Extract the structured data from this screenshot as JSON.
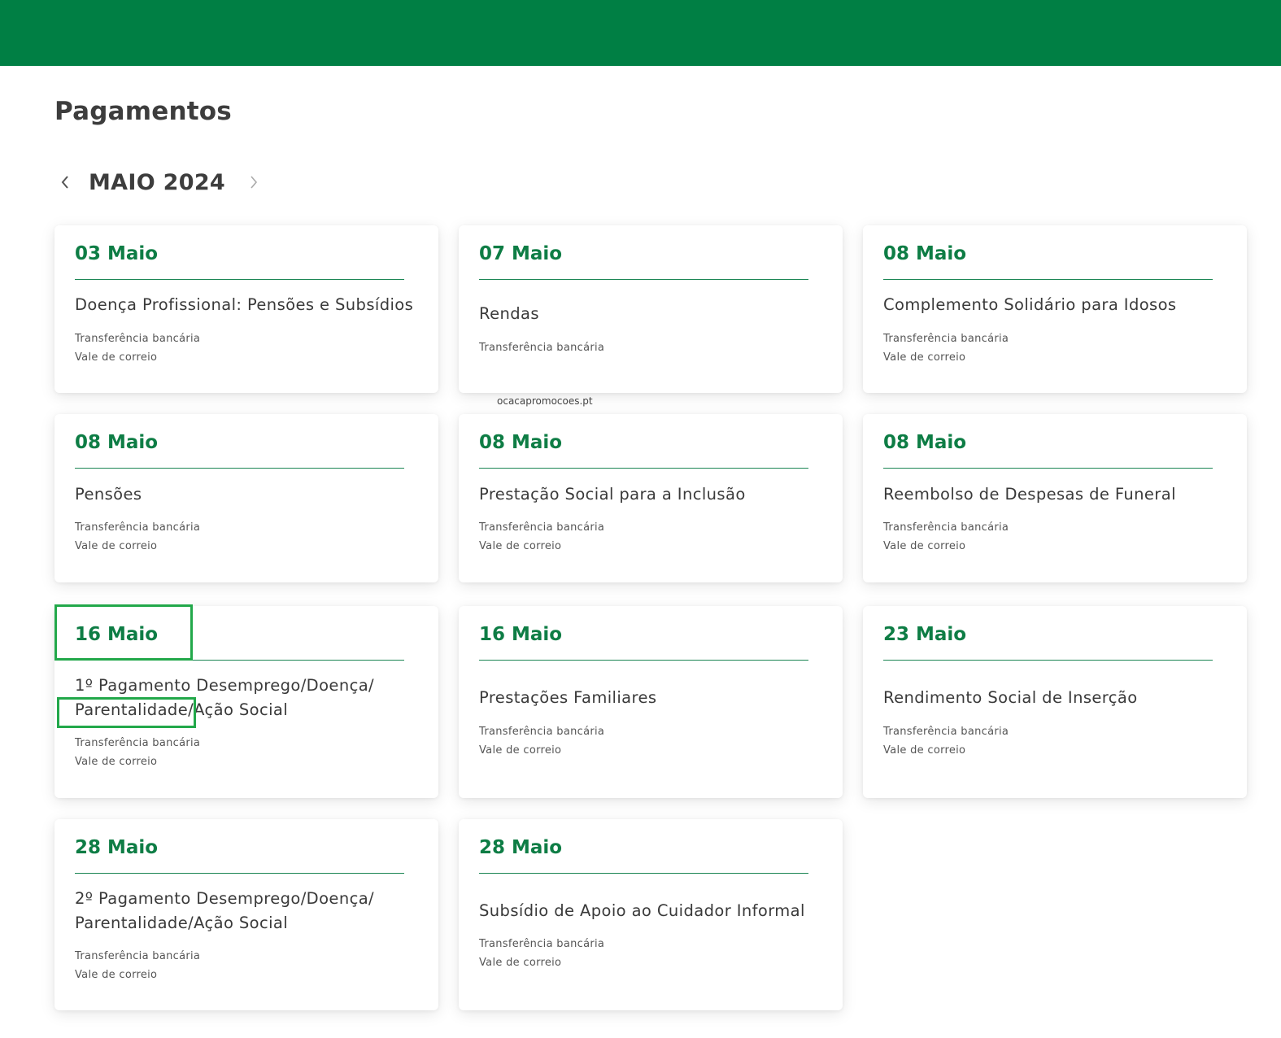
{
  "page": {
    "title": "Pagamentos",
    "month": "MAIO 2024",
    "watermark": "ocacapromocoes.pt",
    "accent_color": "#007f44",
    "date_color": "#0e7d45"
  },
  "cards": [
    {
      "date": "03 Maio",
      "title": "Doença Profissional: Pensões e Subsídios",
      "methods": [
        "Transferência bancária",
        "Vale de correio"
      ]
    },
    {
      "date": "07 Maio",
      "title": "Rendas",
      "methods": [
        "Transferência bancária"
      ]
    },
    {
      "date": "08 Maio",
      "title": "Complemento Solidário para Idosos",
      "methods": [
        "Transferência bancária",
        "Vale de correio"
      ]
    },
    {
      "date": "08 Maio",
      "title": "Pensões",
      "methods": [
        "Transferência bancária",
        "Vale de correio"
      ]
    },
    {
      "date": "08 Maio",
      "title": "Prestação Social para a Inclusão",
      "methods": [
        "Transferência bancária",
        "Vale de correio"
      ]
    },
    {
      "date": "08 Maio",
      "title": "Reembolso de Despesas de Funeral",
      "methods": [
        "Transferência bancária",
        "Vale de correio"
      ]
    },
    {
      "date": "16 Maio",
      "title": "1º Pagamento Desemprego/Doença/ Parentalidade/Ação Social",
      "methods": [
        "Transferência bancária",
        "Vale de correio"
      ]
    },
    {
      "date": "16 Maio",
      "title": "Prestações Familiares",
      "methods": [
        "Transferência bancária",
        "Vale de correio"
      ]
    },
    {
      "date": "23 Maio",
      "title": "Rendimento Social de Inserção",
      "methods": [
        "Transferência bancária",
        "Vale de correio"
      ]
    },
    {
      "date": "28 Maio",
      "title": "2º Pagamento Desemprego/Doença/ Parentalidade/Ação Social",
      "methods": [
        "Transferência bancária",
        "Vale de correio"
      ]
    },
    {
      "date": "28 Maio",
      "title": "Subsídio de Apoio ao Cuidador Informal",
      "methods": [
        "Transferência bancária",
        "Vale de correio"
      ]
    }
  ]
}
